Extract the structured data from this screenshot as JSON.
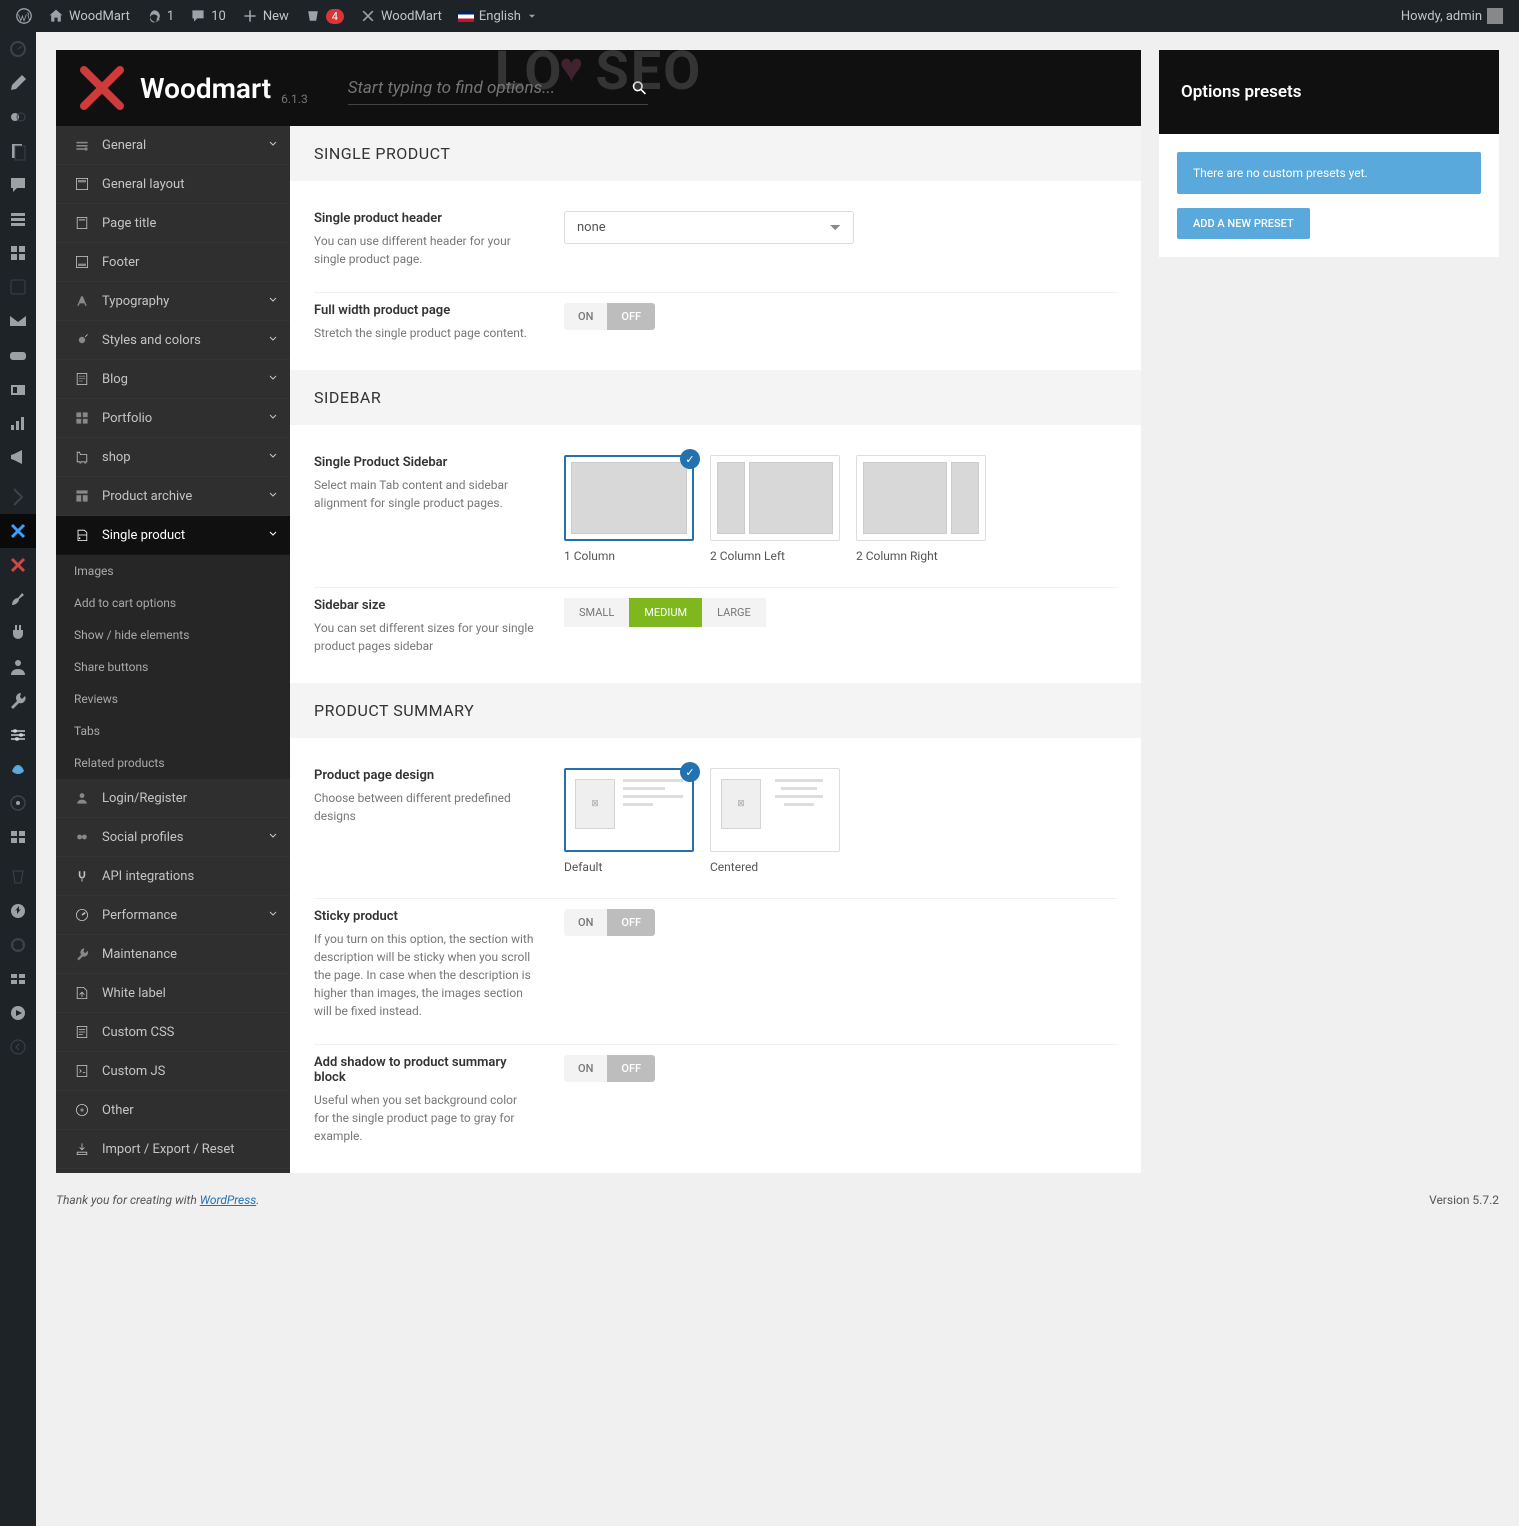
{
  "adminbar": {
    "site": "WoodMart",
    "updates": "1",
    "comments": "10",
    "new": "New",
    "notif": "4",
    "theme": "WoodMart",
    "lang": "English",
    "howdy": "Howdy, admin"
  },
  "themeHeader": {
    "title": "Woodmart",
    "version": "6.1.3",
    "searchPlaceholder": "Start typing to find options..."
  },
  "watermark": {
    "l": "LO",
    "r": "SEO"
  },
  "sidebar": {
    "items": [
      {
        "label": "General",
        "chev": true
      },
      {
        "label": "General layout"
      },
      {
        "label": "Page title"
      },
      {
        "label": "Footer"
      },
      {
        "label": "Typography",
        "chev": true
      },
      {
        "label": "Styles and colors",
        "chev": true
      },
      {
        "label": "Blog",
        "chev": true
      },
      {
        "label": "Portfolio",
        "chev": true
      },
      {
        "label": "shop",
        "chev": true
      },
      {
        "label": "Product archive",
        "chev": true
      },
      {
        "label": "Single product",
        "active": true,
        "chev": true
      },
      {
        "label": "Login/Register"
      },
      {
        "label": "Social profiles",
        "chev": true
      },
      {
        "label": "API integrations"
      },
      {
        "label": "Performance",
        "chev": true
      },
      {
        "label": "Maintenance"
      },
      {
        "label": "White label"
      },
      {
        "label": "Custom CSS"
      },
      {
        "label": "Custom JS"
      },
      {
        "label": "Other"
      },
      {
        "label": "Import / Export / Reset"
      }
    ],
    "sub": [
      "Images",
      "Add to cart options",
      "Show / hide elements",
      "Share buttons",
      "Reviews",
      "Tabs",
      "Related products"
    ]
  },
  "sections": {
    "s1": {
      "title": "SINGLE PRODUCT",
      "f1": {
        "title": "Single product header",
        "desc": "You can use different header for your single product page.",
        "value": "none"
      },
      "f2": {
        "title": "Full width product page",
        "desc": "Stretch the single product page content.",
        "on": "ON",
        "off": "OFF"
      }
    },
    "s2": {
      "title": "SIDEBAR",
      "f1": {
        "title": "Single Product Sidebar",
        "desc": "Select main Tab content and sidebar alignment for single product pages.",
        "opts": [
          "1 Column",
          "2 Column Left",
          "2 Column Right"
        ]
      },
      "f2": {
        "title": "Sidebar size",
        "desc": "You can set different sizes for your single product pages sidebar",
        "small": "SMALL",
        "medium": "MEDIUM",
        "large": "LARGE"
      }
    },
    "s3": {
      "title": "PRODUCT SUMMARY",
      "f1": {
        "title": "Product page design",
        "desc": "Choose between different predefined designs",
        "opts": [
          "Default",
          "Centered"
        ]
      },
      "f2": {
        "title": "Sticky product",
        "desc": "If you turn on this option, the section with description will be sticky when you scroll the page. In case when the description is higher than images, the images section will be fixed instead.",
        "on": "ON",
        "off": "OFF"
      },
      "f3": {
        "title": "Add shadow to product summary block",
        "desc": "Useful when you set background color for the single product page to gray for example.",
        "on": "ON",
        "off": "OFF"
      }
    }
  },
  "presets": {
    "header": "Options presets",
    "info": "There are no custom presets yet.",
    "btn": "ADD A NEW PRESET"
  },
  "footer": {
    "thanks": "Thank you for creating with ",
    "wp": "WordPress",
    "dot": ".",
    "version": "Version 5.7.2"
  }
}
